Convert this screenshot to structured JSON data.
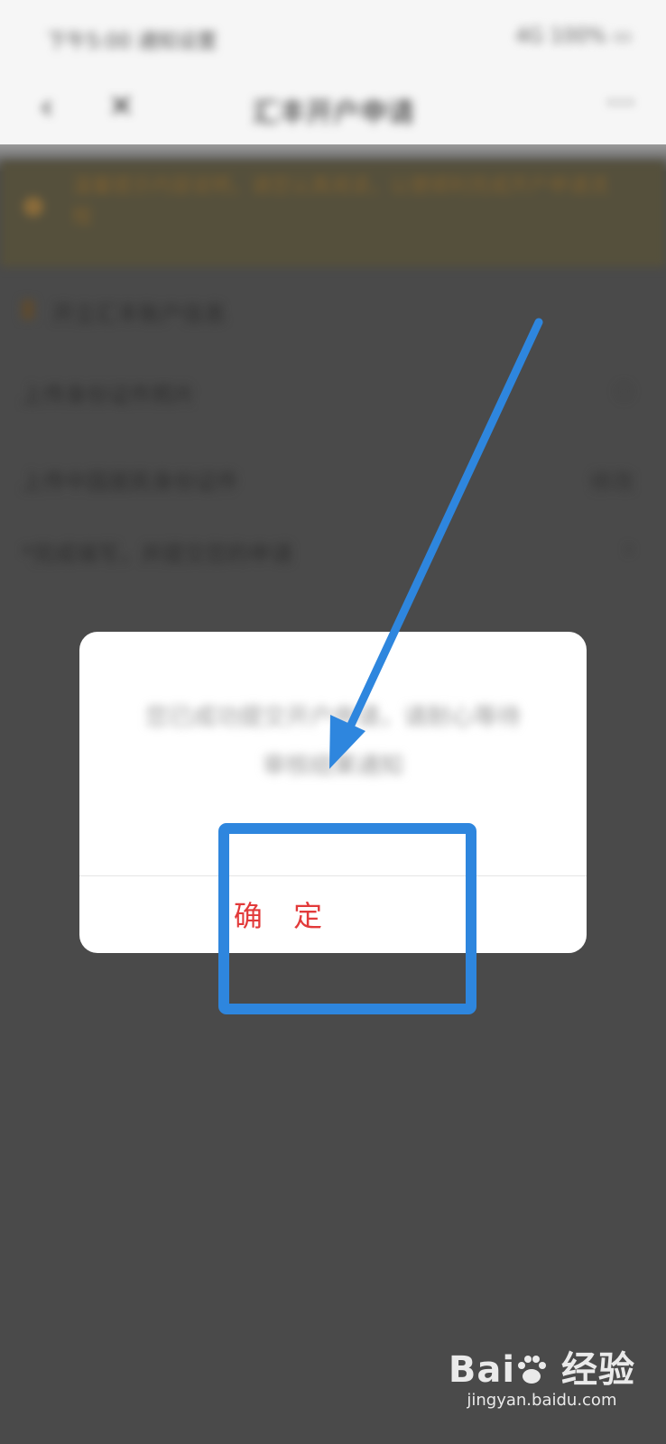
{
  "status_bar": {
    "left_text": "下午5:00 通知设置",
    "right_text": "4G 100% ▭"
  },
  "nav": {
    "title": "汇丰开户申请",
    "back_icon": "chevron-left-icon",
    "close_icon": "close-icon",
    "more_icon": "more-icon"
  },
  "banner": {
    "text": "温馨提示内容说明，请您认真阅读，以便顺利完成开户申请流程"
  },
  "rows": [
    {
      "text": "开立汇丰账户信息",
      "value": ""
    },
    {
      "text": "上传身份证件照片",
      "value": "◌"
    },
    {
      "text": "上传中国居民身份证件",
      "value": "修改"
    },
    {
      "text": "*完成填写，并提交您的申请",
      "value": "›"
    }
  ],
  "dialog": {
    "message_line1": "您已成功提交开户申请，请耐心等待",
    "message_line2": "审核结果通知",
    "confirm_label": "确 定"
  },
  "watermark": {
    "brand": "Baidu 经验",
    "site": "jingyan.baidu.com"
  },
  "colors": {
    "confirm": "#e23a3a",
    "annotation": "#2e86de",
    "overlay": "#4a4a4a"
  }
}
